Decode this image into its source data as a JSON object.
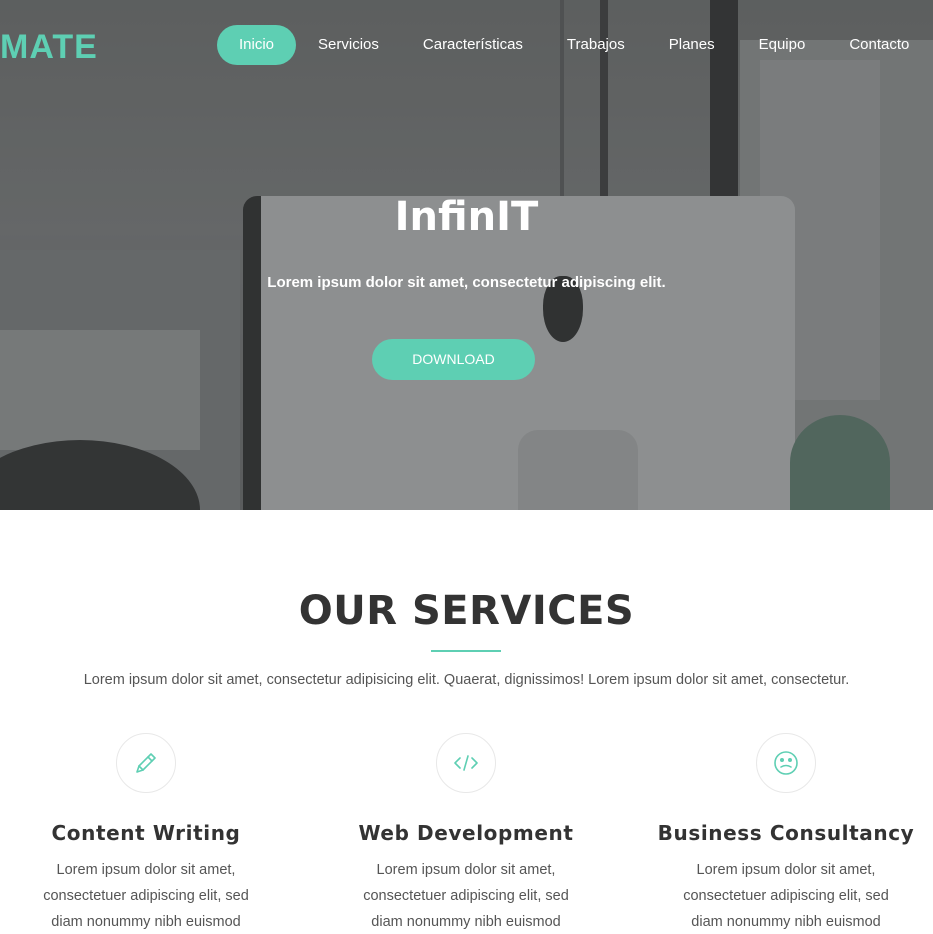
{
  "brand": {
    "logo": "MATE"
  },
  "nav": {
    "items": [
      {
        "label": "Inicio"
      },
      {
        "label": "Servicios"
      },
      {
        "label": "Características"
      },
      {
        "label": "Trabajos"
      },
      {
        "label": "Planes"
      },
      {
        "label": "Equipo"
      },
      {
        "label": "Contacto"
      }
    ]
  },
  "hero": {
    "title": "InfinIT",
    "subtitle": "Lorem ipsum dolor sit amet, consectetur adipiscing elit.",
    "button_label": "DOWNLOAD"
  },
  "services": {
    "title": "OUR SERVICES",
    "description": "Lorem ipsum dolor sit amet, consectetur adipisicing elit. Quaerat, dignissimos! Lorem ipsum dolor sit amet, consectetur.",
    "items": [
      {
        "icon": "pencil-icon",
        "title": "Content Writing",
        "text": "Lorem ipsum dolor sit amet, consectetuer adipiscing elit, sed diam nonummy nibh euismod"
      },
      {
        "icon": "code-icon",
        "title": "Web Development",
        "text": "Lorem ipsum dolor sit amet, consectetuer adipiscing elit, sed diam nonummy nibh euismod"
      },
      {
        "icon": "smiley-icon",
        "title": "Business Consultancy",
        "text": "Lorem ipsum dolor sit amet, consectetuer adipiscing elit, sed diam nonummy nibh euismod"
      }
    ]
  },
  "colors": {
    "accent": "#5ecfb3",
    "heading": "#333333",
    "body_text": "#555555"
  }
}
